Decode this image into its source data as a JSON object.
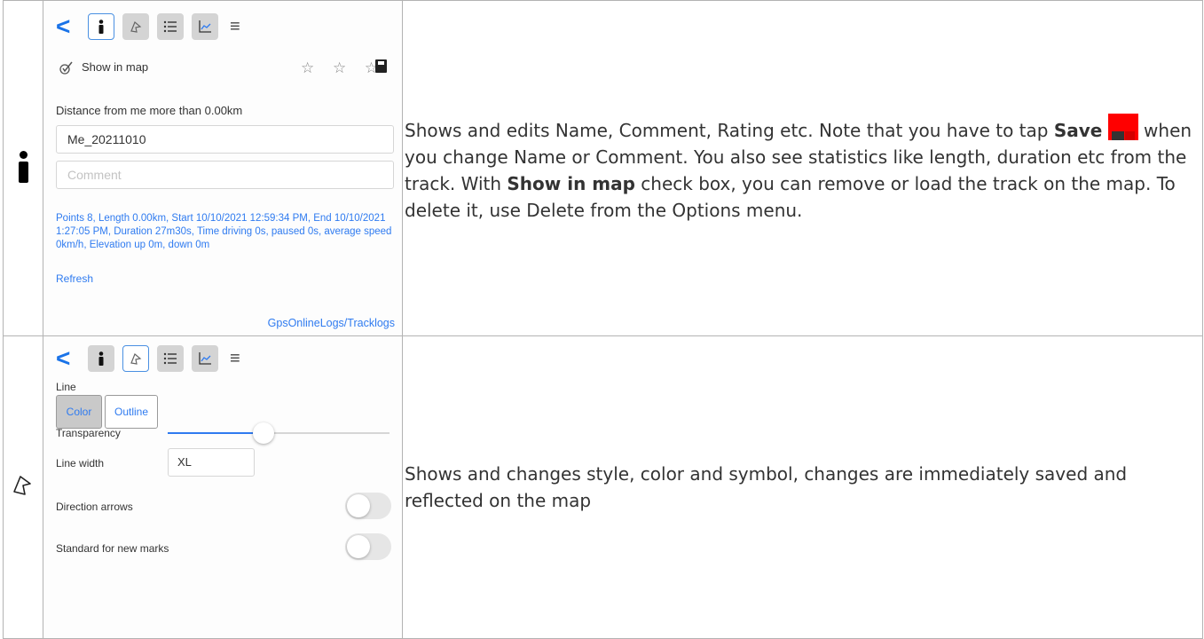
{
  "row1": {
    "toolbar": {
      "back": "<",
      "menu": "≡"
    },
    "show_in_map": "Show in map",
    "stars": "☆ ☆ ☆",
    "distance_label": "Distance from me more than 0.00km",
    "name_value": "Me_20211010",
    "comment_placeholder": "Comment",
    "stats": "Points 8, Length 0.00km, Start 10/10/2021 12:59:34 PM, End 10/10/2021 1:27:05 PM, Duration 27m30s, Time driving 0s, paused 0s, average speed 0km/h, Elevation up 0m, down 0m",
    "refresh": "Refresh",
    "path": "GpsOnlineLogs/Tracklogs",
    "desc": {
      "p1": "Shows and edits Name, Comment, Rating etc. Note that you have to tap ",
      "save_bold": "Save",
      "p2": " when you change Name or Comment. You also see statistics like length, duration etc from the track. With ",
      "show_bold": "Show in map",
      "p3": " check box, you can remove or load the track on the map. To delete it, use Delete from the Options menu."
    }
  },
  "row2": {
    "toolbar": {
      "back": "<",
      "menu": "≡"
    },
    "line_label": "Line",
    "color_btn": "Color",
    "outline_btn": "Outline",
    "transparency_label": "Transparency",
    "transparency_value": 0.43,
    "line_width_label": "Line width",
    "line_width_value": "XL",
    "direction_label": "Direction arrows",
    "standard_label": "Standard for new marks",
    "desc": "Shows and changes style, color and symbol, changes are immediately saved and reflected on the map"
  },
  "colors": {
    "accent": "#2f7bf0",
    "save_red": "#ff0000"
  }
}
